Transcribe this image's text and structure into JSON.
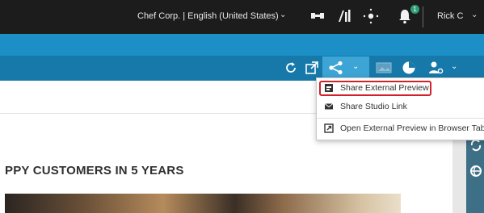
{
  "topbar": {
    "org_label": "Chef Corp. | English (United States)",
    "notification_count": "1",
    "user_label": "Rick C"
  },
  "content": {
    "heading": "PPY CUSTOMERS IN 5 YEARS"
  },
  "share_menu": {
    "items": [
      {
        "label": "Share External Preview",
        "icon": "preview-window-icon",
        "highlighted": true
      },
      {
        "label": "Share Studio Link",
        "icon": "envelope-icon"
      },
      {
        "label": "Open External Preview in Browser Tab",
        "icon": "external-link-icon"
      }
    ]
  },
  "colors": {
    "topbar": "#1c1c1c",
    "toolbar_light": "#1b8fc6",
    "toolbar_dark": "#1779aa",
    "highlight": "#d0222a"
  }
}
